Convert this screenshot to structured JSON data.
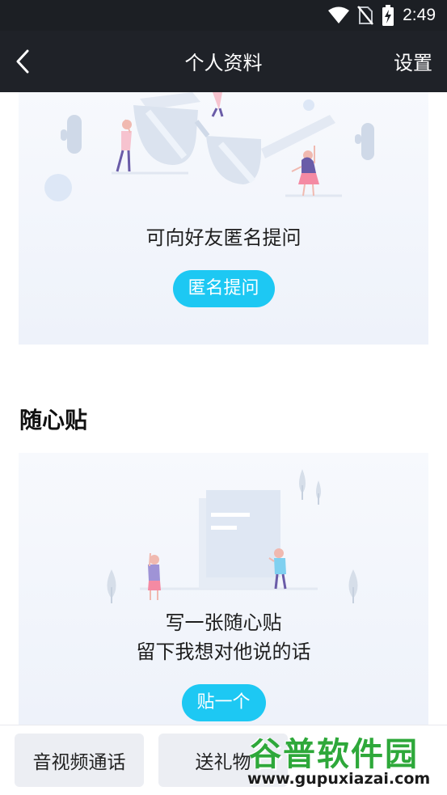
{
  "status_bar": {
    "time": "2:49"
  },
  "title_bar": {
    "title": "个人资料",
    "settings_label": "设置"
  },
  "ask_card": {
    "text": "可向好友匿名提问",
    "button_label": "匿名提问"
  },
  "note_section": {
    "title": "随心贴",
    "text_line1": "写一张随心贴",
    "text_line2": "留下我想对他说的话",
    "button_label": "贴一个"
  },
  "bottom_bar": {
    "video_call_label": "音视频通话",
    "gift_label": "送礼物"
  },
  "watermark": {
    "title": "谷普软件园",
    "url": "www.gupuxiazai.com"
  },
  "colors": {
    "accent": "#1dc8f3",
    "header": "#1f2228",
    "watermark_green": "#2ea83a"
  }
}
